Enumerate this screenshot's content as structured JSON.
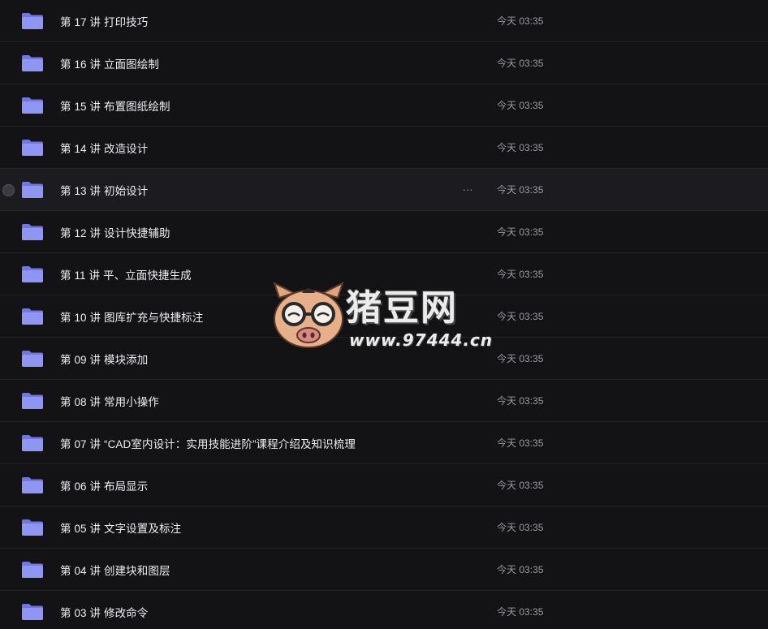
{
  "files": [
    {
      "name": "第 17 讲 打印技巧",
      "time": "今天 03:35"
    },
    {
      "name": "第 16 讲 立面图绘制",
      "time": "今天 03:35"
    },
    {
      "name": "第 15 讲 布置图纸绘制",
      "time": "今天 03:35"
    },
    {
      "name": "第 14 讲 改造设计",
      "time": "今天 03:35"
    },
    {
      "name": "第 13 讲 初始设计",
      "time": "今天 03:35",
      "hovered": true,
      "more": "···"
    },
    {
      "name": "第 12 讲 设计快捷辅助",
      "time": "今天 03:35"
    },
    {
      "name": "第 11 讲 平、立面快捷生成",
      "time": "今天 03:35"
    },
    {
      "name": "第 10 讲 图库扩充与快捷标注",
      "time": "今天 03:35"
    },
    {
      "name": "第 09 讲 模块添加",
      "time": "今天 03:35"
    },
    {
      "name": "第 08 讲 常用小操作",
      "time": "今天 03:35"
    },
    {
      "name": "第 07 讲 “CAD室内设计：实用技能进阶”课程介绍及知识梳理",
      "time": "今天 03:35"
    },
    {
      "name": "第 06 讲 布局显示",
      "time": "今天 03:35"
    },
    {
      "name": "第 05 讲 文字设置及标注",
      "time": "今天 03:35"
    },
    {
      "name": "第 04 讲 创建块和图层",
      "time": "今天 03:35"
    },
    {
      "name": "第 03 讲 修改命令",
      "time": "今天 03:35"
    }
  ],
  "icons": {
    "folder": "folder-icon",
    "more": "more-options-icon",
    "select": "select-radio"
  },
  "colors": {
    "background": "#131316",
    "hover_row": "#1c1c20",
    "folder_front": "#8f95f0",
    "folder_back": "#7177de"
  },
  "watermark": {
    "title": "猪豆网",
    "url": "www.97444.cn"
  }
}
